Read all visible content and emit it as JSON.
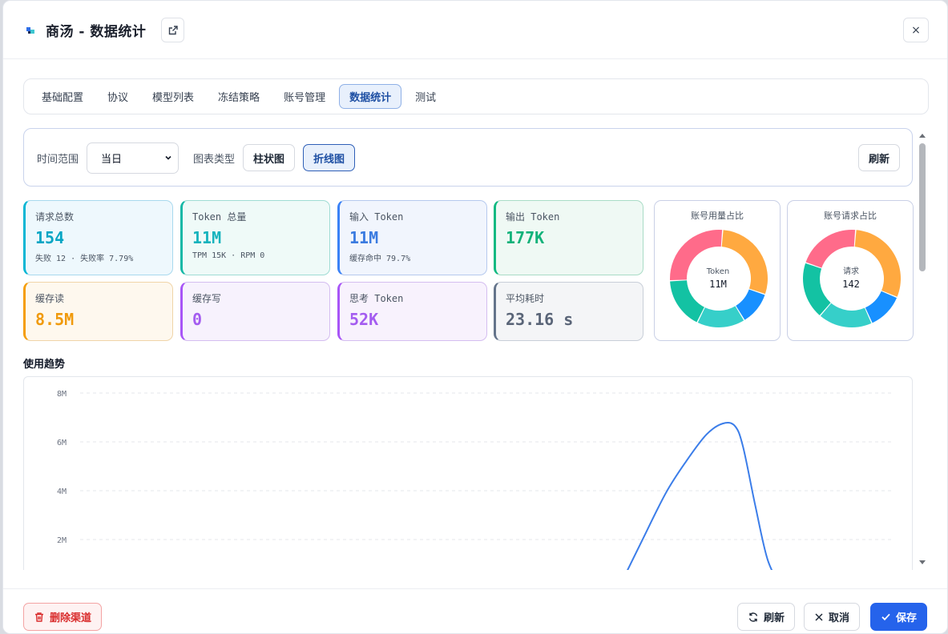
{
  "header": {
    "title": "商汤 - 数据统计",
    "close_label": "×"
  },
  "tabs": [
    {
      "label": "基础配置"
    },
    {
      "label": "协议"
    },
    {
      "label": "模型列表"
    },
    {
      "label": "冻结策略"
    },
    {
      "label": "账号管理"
    },
    {
      "label": "数据统计",
      "active": true
    },
    {
      "label": "测试"
    }
  ],
  "filters": {
    "time_range_label": "时间范围",
    "time_range_value": "当日",
    "chart_type_label": "图表类型",
    "bar_label": "柱状图",
    "line_label": "折线图",
    "selected_chart_type": "折线图",
    "refresh_label": "刷新"
  },
  "stats": {
    "total_requests": {
      "label": "请求总数",
      "value": "154",
      "sub": "失败 12 · 失败率 7.79%",
      "color": "#06b6d4"
    },
    "token_total": {
      "label": "Token 总量",
      "value": "11M",
      "sub": "TPM 15K · RPM 0",
      "color": "#14b8a6"
    },
    "input_token": {
      "label": "输入 Token",
      "value": "11M",
      "sub": "缓存命中 79.7%",
      "color": "#3b82f6"
    },
    "output_token": {
      "label": "输出 Token",
      "value": "177K",
      "color": "#10b981"
    },
    "cache_read": {
      "label": "缓存读",
      "value": "8.5M",
      "color": "#f59e0b"
    },
    "cache_write": {
      "label": "缓存写",
      "value": "0",
      "color": "#a855f7"
    },
    "thinking_token": {
      "label": "思考 Token",
      "value": "52K",
      "color": "#a855f7"
    },
    "avg_latency": {
      "label": "平均耗时",
      "value": "23.16 s",
      "color": "#64748b"
    }
  },
  "donuts": [
    {
      "title": "账号用量占比",
      "center_label": "Token",
      "center_value": "11M",
      "colors": [
        "#ffa940",
        "#1890ff",
        "#36cfc9",
        "#13c2a3",
        "#ff6b8a"
      ],
      "shares": [
        0.29,
        0.11,
        0.16,
        0.17,
        0.27
      ]
    },
    {
      "title": "账号请求占比",
      "center_label": "请求",
      "center_value": "142",
      "colors": [
        "#ffa940",
        "#1890ff",
        "#36cfc9",
        "#13c2a3",
        "#ff6b8a"
      ],
      "shares": [
        0.3,
        0.12,
        0.18,
        0.19,
        0.21
      ]
    }
  ],
  "trend": {
    "title": "使用趋势"
  },
  "chart_data": {
    "type": "line",
    "title": "",
    "y_ticks": [
      "8M",
      "6M",
      "4M",
      "2M"
    ],
    "ylim": [
      0,
      8000000
    ],
    "x_range": [
      0,
      1
    ],
    "x": [
      0.662,
      0.69,
      0.72,
      0.745,
      0.77,
      0.79,
      0.805,
      0.815,
      0.83,
      0.845,
      0.862
    ],
    "values": [
      0,
      1900000,
      3900000,
      5200000,
      6300000,
      6750000,
      6650000,
      5800000,
      3400000,
      1200000,
      0
    ],
    "color": "#3b7de9",
    "grid": true
  },
  "footer": {
    "delete_label": "删除渠道",
    "refresh_label": "刷新",
    "cancel_label": "取消",
    "save_label": "保存"
  }
}
